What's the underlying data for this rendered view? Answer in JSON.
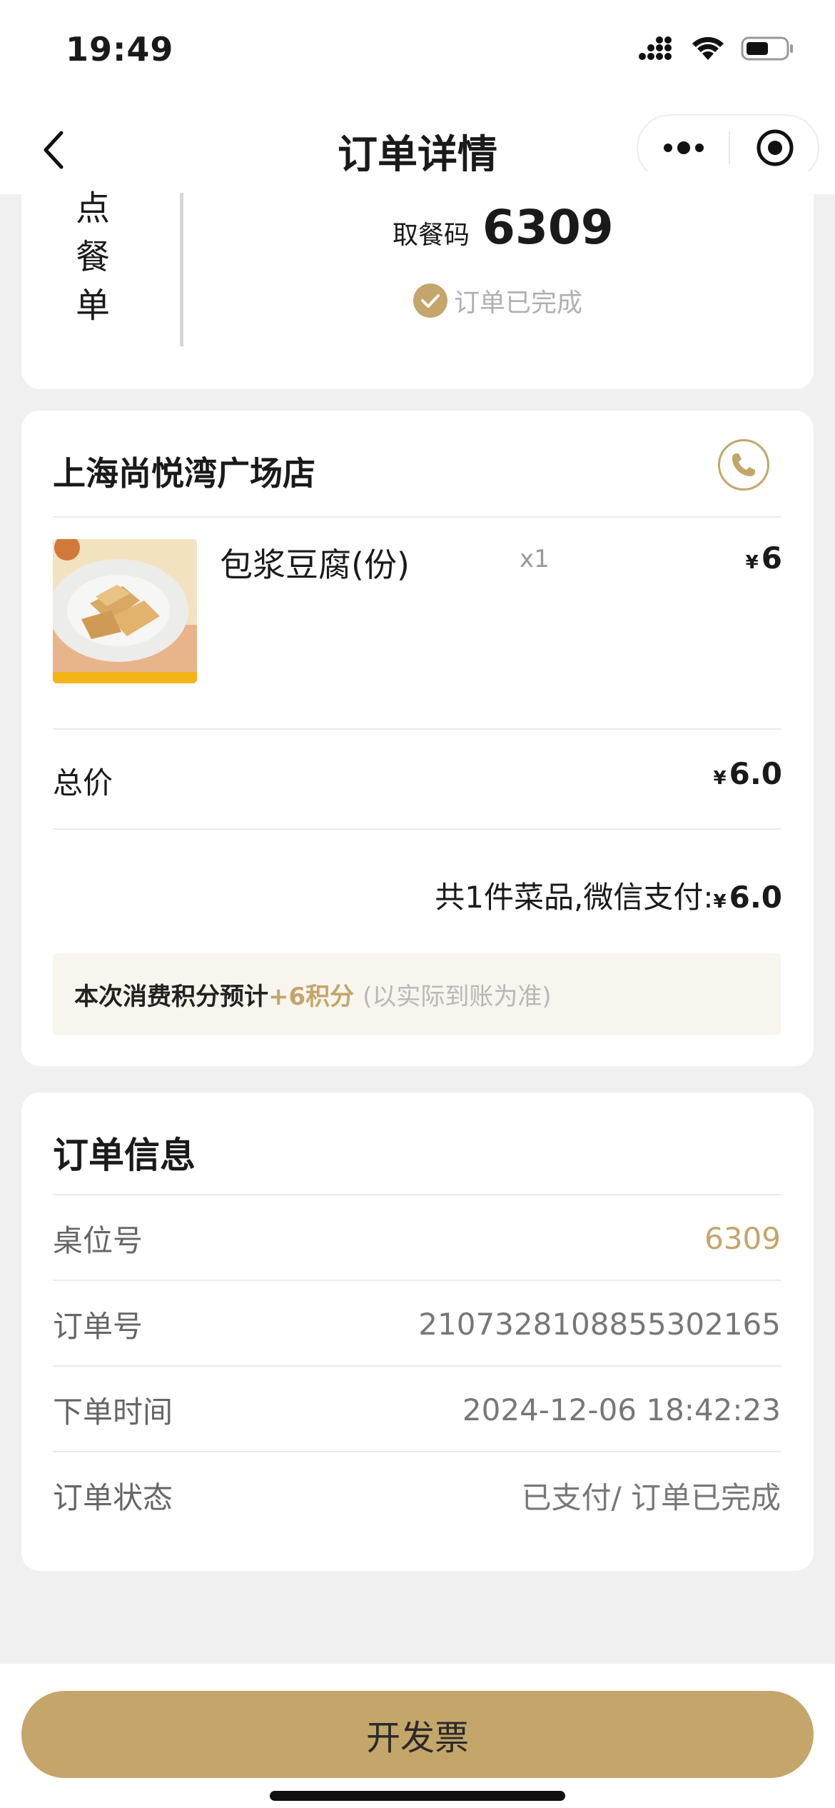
{
  "status_bar": {
    "time": "19:49"
  },
  "nav": {
    "title": "订单详情"
  },
  "pickup_card": {
    "vertical_label": [
      "点",
      "餐",
      "单"
    ],
    "pickup_label": "取餐码",
    "pickup_code": "6309",
    "status": "订单已完成"
  },
  "order_card": {
    "store_name": "上海尚悦湾广场店",
    "items": [
      {
        "name": "包浆豆腐(份)",
        "qty": "x1",
        "currency": "¥",
        "price": "6"
      }
    ],
    "total_label": "总价",
    "total_currency": "¥",
    "total_value": "6.0",
    "summary_text": "共1件菜品,微信支付:",
    "summary_currency": "¥",
    "summary_amount": "6.0",
    "points_text": "本次消费积分预计",
    "points_value": "+6积分",
    "points_note": "(以实际到账为准)"
  },
  "info_card": {
    "title": "订单信息",
    "rows": [
      {
        "label": "桌位号",
        "value": "6309"
      },
      {
        "label": "订单号",
        "value": "2107328108855302165"
      },
      {
        "label": "下单时间",
        "value": "2024-12-06 18:42:23"
      },
      {
        "label": "订单状态",
        "value": "已支付/ 订单已完成"
      }
    ]
  },
  "bottom": {
    "invoice_button": "开发票"
  },
  "colors": {
    "accent": "#c4a56a",
    "background": "#f0f0f0"
  }
}
